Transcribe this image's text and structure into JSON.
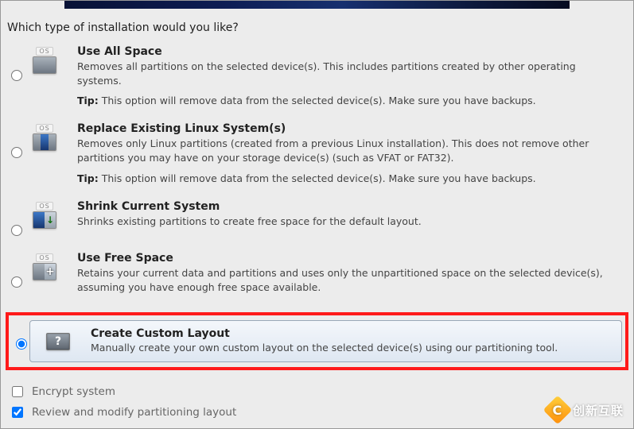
{
  "question": "Which type of installation would you like?",
  "os_tag": "OS",
  "options": {
    "use_all_space": {
      "title": "Use All Space",
      "desc": "Removes all partitions on the selected device(s).  This includes partitions created by other operating systems.",
      "tip_label": "Tip:",
      "tip_text": "This option will remove data from the selected device(s).  Make sure you have backups."
    },
    "replace_linux": {
      "title": "Replace Existing Linux System(s)",
      "desc": "Removes only Linux partitions (created from a previous Linux installation).  This does not remove other partitions you may have on your storage device(s) (such as VFAT or FAT32).",
      "tip_label": "Tip:",
      "tip_text": "This option will remove data from the selected device(s).  Make sure you have backups."
    },
    "shrink": {
      "title": "Shrink Current System",
      "desc": "Shrinks existing partitions to create free space for the default layout."
    },
    "use_free_space": {
      "title": "Use Free Space",
      "desc": "Retains your current data and partitions and uses only the unpartitioned space on the selected device(s), assuming you have enough free space available."
    },
    "custom": {
      "title": "Create Custom Layout",
      "desc": "Manually create your own custom layout on the selected device(s) using our partitioning tool."
    }
  },
  "checkboxes": {
    "encrypt": {
      "label": "Encrypt system",
      "checked": false
    },
    "review": {
      "label": "Review and modify partitioning layout",
      "checked": true
    }
  },
  "watermark": {
    "text": "创新互联",
    "icon_letter": "C"
  }
}
